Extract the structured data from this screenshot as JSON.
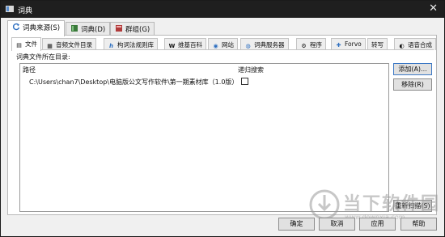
{
  "window": {
    "title": "词典"
  },
  "outer_tabs": [
    {
      "label": "词典来源(S)",
      "icon": "refresh-icon"
    },
    {
      "label": "词典(D)",
      "icon": "book-icon"
    },
    {
      "label": "群组(G)",
      "icon": "group-icon"
    }
  ],
  "inner_tabs": [
    {
      "label": "文件",
      "icon": "file-icon"
    },
    {
      "label": "音频文件目录",
      "icon": "audio-folder-icon"
    },
    {
      "label": "构词法规则库",
      "icon": "h-icon"
    },
    {
      "label": "维基百科",
      "icon": "wikipedia-icon"
    },
    {
      "label": "网站",
      "icon": "globe-icon"
    },
    {
      "label": "词典服务器",
      "icon": "server-icon"
    },
    {
      "label": "程序",
      "icon": "program-icon"
    },
    {
      "label": "Forvo",
      "icon": "forvo-icon"
    },
    {
      "label": "转写",
      "icon": "transliteration-icon"
    },
    {
      "label": "语音合成",
      "icon": "speech-icon"
    }
  ],
  "files": {
    "section_label": "词典文件所在目录:",
    "columns": [
      "路径",
      "递归搜索"
    ],
    "rows": [
      {
        "path": "C:\\Users\\chan7\\Desktop\\电脑版公文写作软件\\第一期素材库（1.0版）",
        "recursive": false
      }
    ],
    "add_label": "添加(A)...",
    "remove_label": "移除(R)",
    "rescan_label": "重新扫描(S)"
  },
  "footer": {
    "ok": "确定",
    "cancel": "取消",
    "apply": "应用",
    "help": "帮助"
  },
  "watermark": {
    "name": "当下软件园",
    "url": "www.downxia.com"
  },
  "colors": {
    "titlebar": "#1f1f1f",
    "tab_active": "#ffffff",
    "button_bg": "#e1e1e1",
    "button_focus_border": "#3b78c4"
  }
}
